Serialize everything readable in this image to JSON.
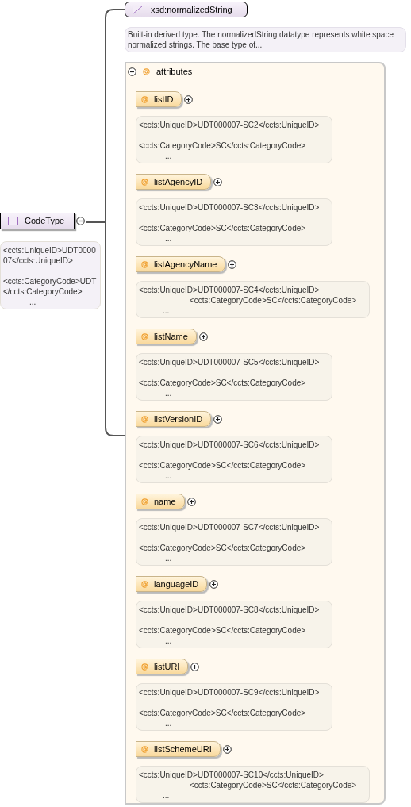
{
  "root": {
    "name": "CodeType",
    "expanded": true,
    "annotation": {
      "kind": "spaced",
      "lines": [
        "<ccts:UniqueID>UDT000007</ccts:UniqueID>",
        "<ccts:CategoryCode>UDT</ccts:CategoryCode>",
        "..."
      ]
    }
  },
  "base_type": {
    "name": "xsd:normalizedString",
    "description": "Built-in derived type. The normalizedString datatype represents white space normalized strings. The base type of..."
  },
  "attributes": {
    "label": "attributes",
    "expanded": true,
    "items": [
      {
        "name": "listID",
        "expanded": false,
        "annotation": {
          "kind": "spaced",
          "lines": [
            "<ccts:UniqueID>UDT000007-SC2</ccts:UniqueID>",
            "<ccts:CategoryCode>SC</ccts:CategoryCode>",
            "..."
          ]
        }
      },
      {
        "name": "listAgencyID",
        "expanded": false,
        "annotation": {
          "kind": "spaced",
          "lines": [
            "<ccts:UniqueID>UDT000007-SC3</ccts:UniqueID>",
            "<ccts:CategoryCode>SC</ccts:CategoryCode>",
            "..."
          ]
        }
      },
      {
        "name": "listAgencyName",
        "expanded": false,
        "annotation": {
          "kind": "indented",
          "lines": [
            "<ccts:UniqueID>UDT000007-SC4</ccts:UniqueID>",
            "<ccts:CategoryCode>SC</ccts:CategoryCode>",
            "..."
          ]
        }
      },
      {
        "name": "listName",
        "expanded": false,
        "annotation": {
          "kind": "spaced",
          "lines": [
            "<ccts:UniqueID>UDT000007-SC5</ccts:UniqueID>",
            "<ccts:CategoryCode>SC</ccts:CategoryCode>",
            "..."
          ]
        }
      },
      {
        "name": "listVersionID",
        "expanded": false,
        "annotation": {
          "kind": "spaced",
          "lines": [
            "<ccts:UniqueID>UDT000007-SC6</ccts:UniqueID>",
            "<ccts:CategoryCode>SC</ccts:CategoryCode>",
            "..."
          ]
        }
      },
      {
        "name": "name",
        "expanded": false,
        "annotation": {
          "kind": "spaced",
          "lines": [
            "<ccts:UniqueID>UDT000007-SC7</ccts:UniqueID>",
            "<ccts:CategoryCode>SC</ccts:CategoryCode>",
            "..."
          ]
        }
      },
      {
        "name": "languageID",
        "expanded": false,
        "annotation": {
          "kind": "spaced",
          "lines": [
            "<ccts:UniqueID>UDT000007-SC8</ccts:UniqueID>",
            "<ccts:CategoryCode>SC</ccts:CategoryCode>",
            "..."
          ]
        }
      },
      {
        "name": "listURI",
        "expanded": false,
        "annotation": {
          "kind": "spaced",
          "lines": [
            "<ccts:UniqueID>UDT000007-SC9</ccts:UniqueID>",
            "<ccts:CategoryCode>SC</ccts:CategoryCode>",
            "..."
          ]
        }
      },
      {
        "name": "listSchemeURI",
        "expanded": false,
        "annotation": {
          "kind": "indented",
          "lines": [
            "<ccts:UniqueID>UDT000007-SC10</ccts:UniqueID>",
            "<ccts:CategoryCode>SC</ccts:CategoryCode>",
            "..."
          ]
        }
      }
    ]
  }
}
